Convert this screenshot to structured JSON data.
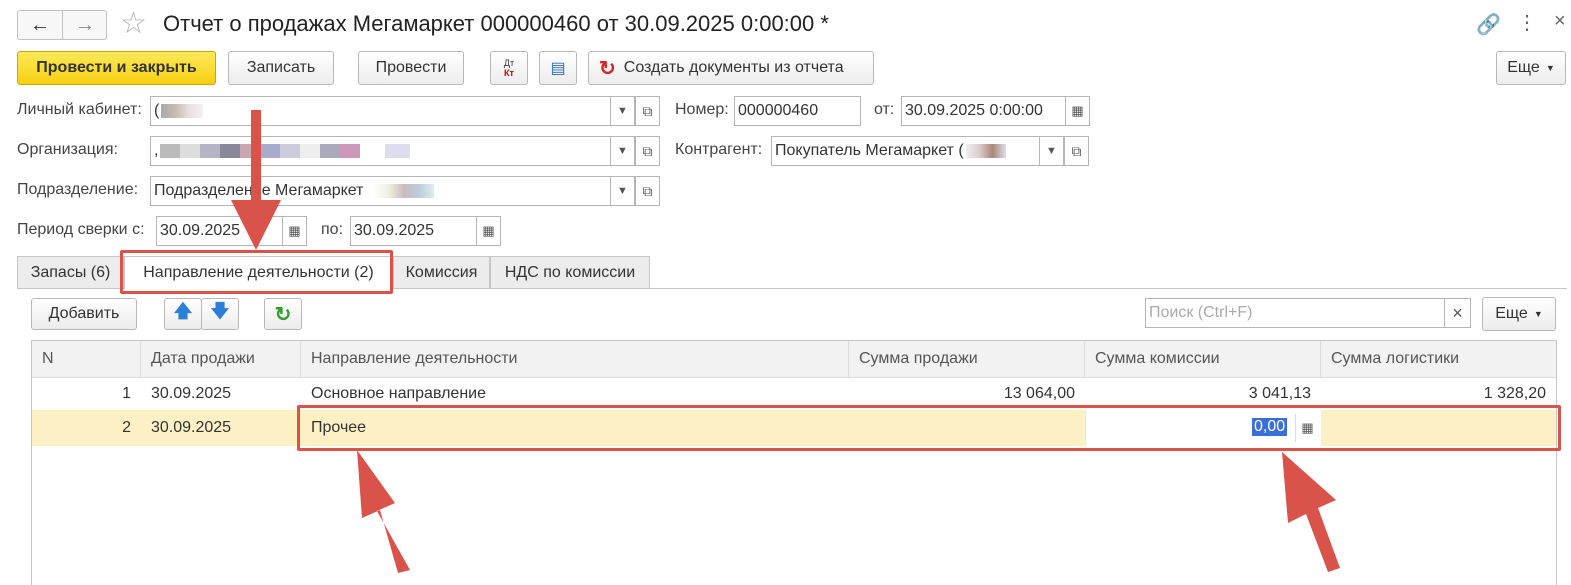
{
  "window": {
    "title": "Отчет о продажах Мегамаркет 000000460 от 30.09.2025 0:00:00 *"
  },
  "toolbar": {
    "post_close": "Провести и закрыть",
    "save": "Записать",
    "post": "Провести",
    "dtkt_top": "Дт",
    "dtkt_bottom": "Кт",
    "create_docs": "Создать документы из отчета",
    "more": "Еще"
  },
  "form": {
    "cabinet_label": "Личный кабинет:",
    "cabinet_value": "(",
    "org_label": "Организация:",
    "org_value": ",",
    "division_label": "Подразделение:",
    "division_value": "Подразделение Мегамаркет",
    "period_label": "Период сверки с:",
    "period_from": "30.09.2025",
    "period_to_label": "по:",
    "period_to": "30.09.2025",
    "number_label": "Номер:",
    "number_value": "000000460",
    "date_label": "от:",
    "date_value": "30.09.2025  0:00:00",
    "counterparty_label": "Контрагент:",
    "counterparty_value": "Покупатель Мегамаркет ("
  },
  "tabs": [
    {
      "label": "Запасы (6)"
    },
    {
      "label": "Направление деятельности (2)"
    },
    {
      "label": "Комиссия"
    },
    {
      "label": "НДС по комиссии"
    }
  ],
  "table_toolbar": {
    "add": "Добавить",
    "search_placeholder": "Поиск (Ctrl+F)",
    "clear": "×",
    "more": "Еще"
  },
  "table": {
    "columns": [
      "N",
      "Дата продажи",
      "Направление деятельности",
      "Сумма продажи",
      "Сумма комиссии",
      "Сумма логистики"
    ],
    "rows": [
      {
        "n": "1",
        "date": "30.09.2025",
        "direction": "Основное направление",
        "sale": "13 064,00",
        "commission": "3 041,13",
        "logistics": "1 328,20"
      },
      {
        "n": "2",
        "date": "30.09.2025",
        "direction": "Прочее",
        "sale": "",
        "commission": "0,00",
        "logistics": ""
      }
    ]
  },
  "colors": {
    "accent_yellow": "#f5d010",
    "selected_row": "#fdf0c4",
    "annotation_red": "#d9534a",
    "selection_blue": "#3a6fd8"
  }
}
